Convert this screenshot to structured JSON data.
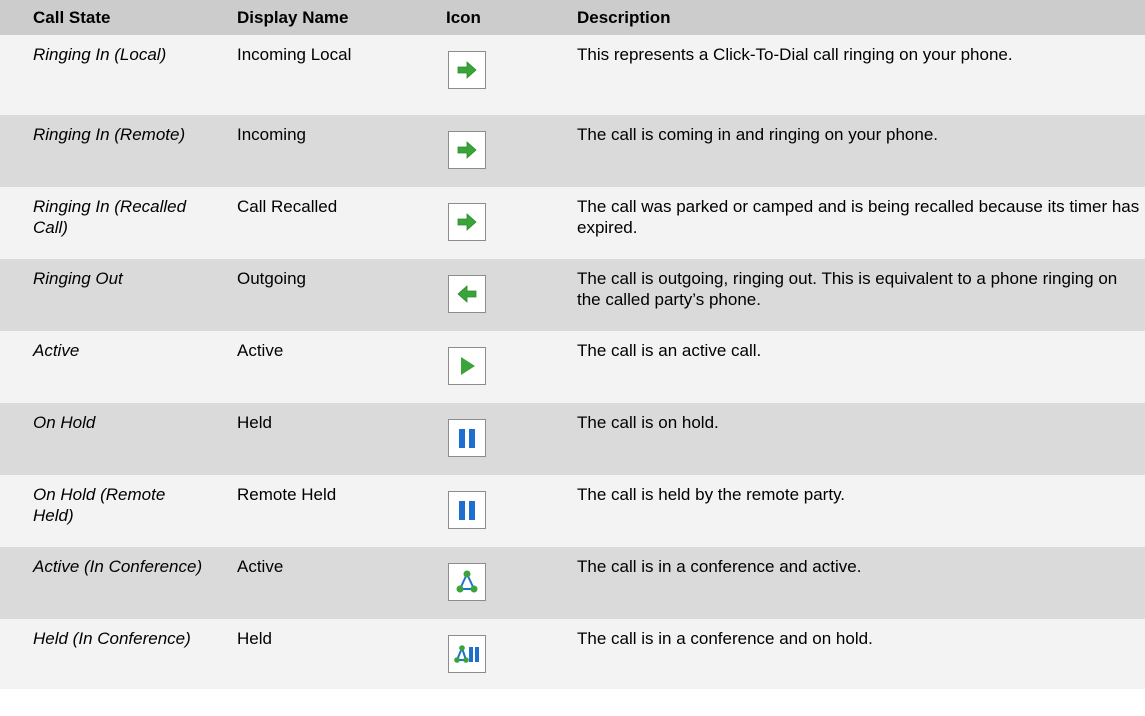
{
  "headers": [
    "Call State",
    "Display Name",
    "Icon",
    "Description"
  ],
  "rows": [
    {
      "call_state": "Ringing In (Local)",
      "display_name": "Incoming Local",
      "icon": "arrow-right-icon",
      "description": "This represents a Click-To-Dial call ringing on your phone."
    },
    {
      "call_state": "Ringing In (Remote)",
      "display_name": "Incoming",
      "icon": "arrow-right-icon",
      "description": "The call is coming in and ringing on your phone."
    },
    {
      "call_state": "Ringing In (Recalled Call)",
      "display_name": "Call Recalled",
      "icon": "arrow-right-icon",
      "description": "The call was parked or camped and is being recalled because its timer has expired."
    },
    {
      "call_state": "Ringing Out",
      "display_name": "Outgoing",
      "icon": "arrow-left-icon",
      "description": "The call is outgoing, ringing out.  This is equivalent to a phone ringing on the called party’s phone."
    },
    {
      "call_state": "Active",
      "display_name": "Active",
      "icon": "play-icon",
      "description": "The call is an active call."
    },
    {
      "call_state": "On Hold",
      "display_name": "Held",
      "icon": "pause-icon",
      "description": "The call is on hold."
    },
    {
      "call_state": "On Hold (Remote Held)",
      "display_name": "Remote Held",
      "icon": "pause-icon",
      "description": "The call is held by the remote party."
    },
    {
      "call_state": "Active (In Conference)",
      "display_name": "Active",
      "icon": "conference-icon",
      "description": "The call is in a conference and active."
    },
    {
      "call_state": "Held (In Conference)",
      "display_name": "Held",
      "icon": "conference-hold-icon",
      "description": "The call is in a conference and on hold."
    }
  ],
  "colors": {
    "header_bg": "#cccccc",
    "alt_row_bg": "#dadada",
    "green": "#3aa33a",
    "blue": "#1f6fd0"
  }
}
